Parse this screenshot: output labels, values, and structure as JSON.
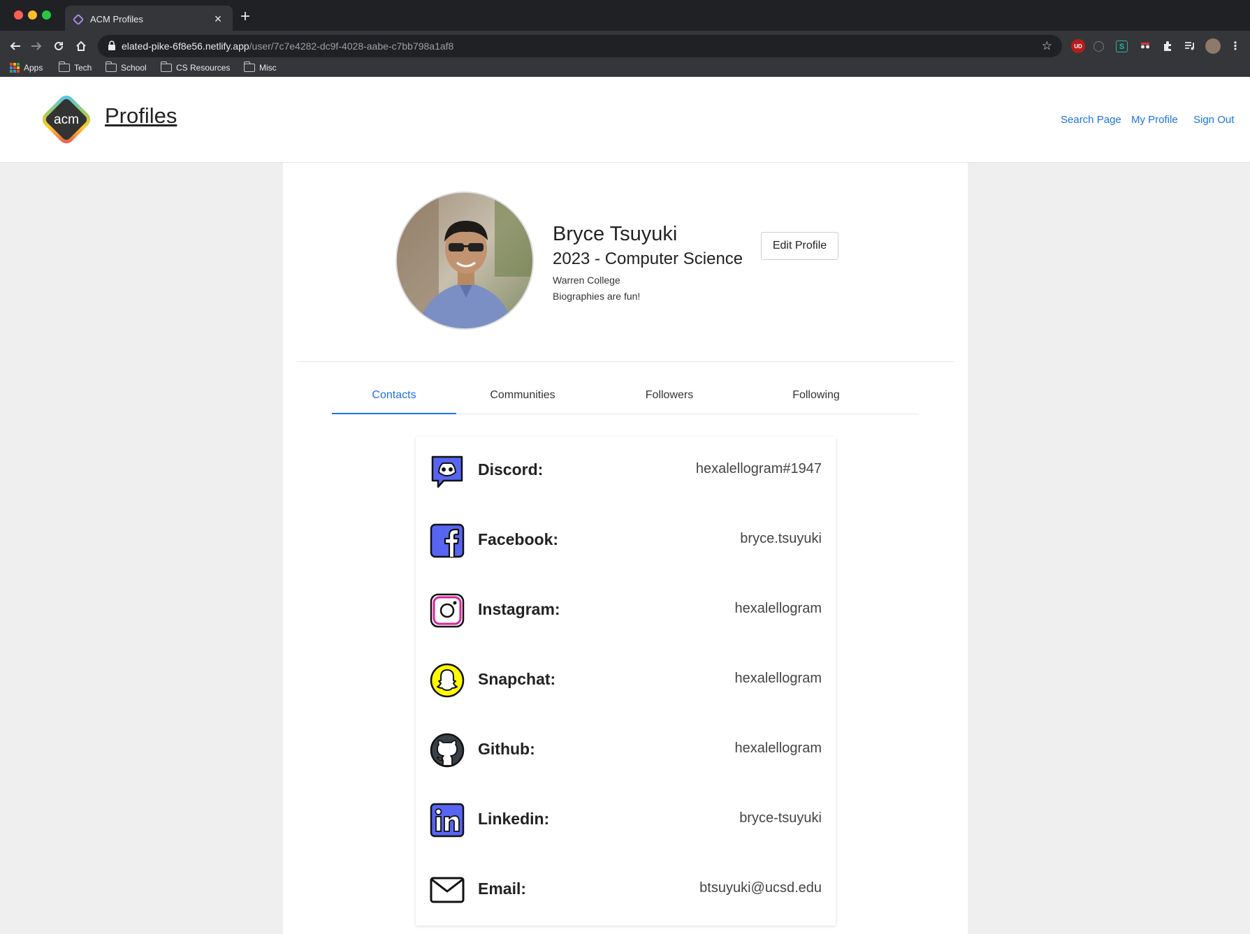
{
  "browser": {
    "tab_title": "ACM Profiles",
    "tab_close": "×",
    "new_tab": "+",
    "url_host": "elated-pike-6f8e56.netlify.app",
    "url_path": "/user/7c7e4282-dc9f-4028-aabe-c7bb798a1af8",
    "star": "☆",
    "bookmarks": [
      "Apps",
      "Tech",
      "School",
      "CS Resources",
      "Misc"
    ],
    "extension_labels": [
      "UD",
      "S"
    ]
  },
  "header": {
    "logo_text": "acm",
    "brand": "Profiles",
    "nav": [
      "Search Page",
      "My Profile",
      "Sign Out"
    ]
  },
  "profile": {
    "name": "Bryce Tsuyuki",
    "major": "2023 - Computer Science",
    "college": "Warren College",
    "bio": "Biographies are fun!",
    "edit_label": "Edit Profile"
  },
  "tabs": [
    "Contacts",
    "Communities",
    "Followers",
    "Following"
  ],
  "active_tab": "Contacts",
  "contacts": [
    {
      "label": "Discord:",
      "value": "hexalellogram#1947",
      "icon": "discord-icon"
    },
    {
      "label": "Facebook:",
      "value": "bryce.tsuyuki",
      "icon": "facebook-icon"
    },
    {
      "label": "Instagram:",
      "value": "hexalellogram",
      "icon": "instagram-icon"
    },
    {
      "label": "Snapchat:",
      "value": "hexalellogram",
      "icon": "snapchat-icon"
    },
    {
      "label": "Github:",
      "value": "hexalellogram",
      "icon": "github-icon"
    },
    {
      "label": "Linkedin:",
      "value": "bryce-tsuyuki",
      "icon": "linkedin-icon"
    },
    {
      "label": "Email:",
      "value": "btsuyuki@ucsd.edu",
      "icon": "email-icon"
    }
  ],
  "colors": {
    "accent": "#1a73e8",
    "page_bg": "#efefef",
    "icon_blue": "#5865f2",
    "snapchat_yellow": "#fffc00"
  }
}
